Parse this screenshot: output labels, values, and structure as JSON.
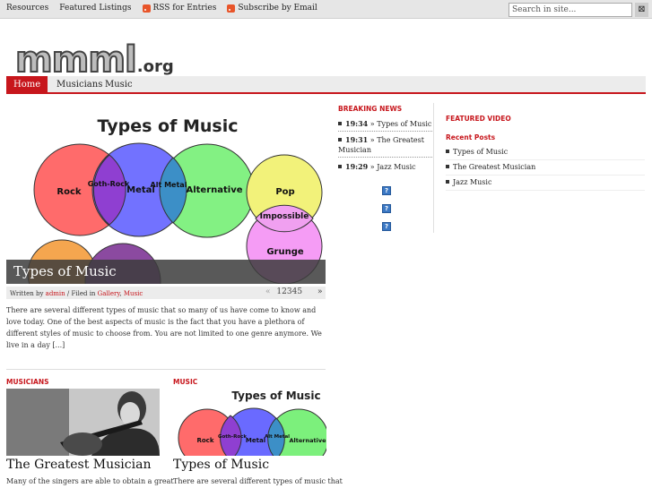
{
  "topbar": {
    "links": [
      "Resources",
      "Featured Listings"
    ],
    "rss_label": "RSS for Entries",
    "email_label": "Subscribe by Email",
    "search_placeholder": "Search in site..."
  },
  "logo": {
    "main": "mmml",
    "suffix": ".org"
  },
  "nav": {
    "items": [
      "Home",
      "Musicians",
      "Music"
    ],
    "active": "Home"
  },
  "featured": {
    "image": {
      "heading": "Types of Music",
      "labels": [
        "Rock",
        "Goth-Rock",
        "Metal",
        "Alt Metal",
        "Alternative",
        "Pop",
        "Impossible",
        "Grunge"
      ]
    },
    "title": "Types of Music",
    "meta_prefix": "Written by",
    "author": "admin",
    "filed_prefix": "/ Filed in",
    "categories": [
      "Gallery",
      "Music"
    ],
    "pages": [
      "1",
      "2",
      "3",
      "4",
      "5"
    ],
    "prev_arrow": "«",
    "next_arrow": "»",
    "excerpt": "There are several different types of music that so many of us have come to know and love today. One of the best aspects of music is the fact that you have a plethora of different styles of music to choose from. You are not limited to one genre anymore. We live in a day [...]"
  },
  "sections": [
    {
      "label": "MUSICIANS",
      "title": "The Greatest Musician",
      "text": "Many of the singers are able to obtain a great"
    },
    {
      "label": "MUSIC",
      "title": "Types of Music",
      "text": "There are several different types of music that",
      "image": {
        "heading": "Types of Music",
        "labels": [
          "Rock",
          "Goth-Rock",
          "Metal",
          "Alt Metal",
          "Alternative"
        ]
      }
    }
  ],
  "breaking": {
    "title": "BREAKING NEWS",
    "items": [
      {
        "time": "19:34",
        "sep": "»",
        "text": "Types of Music"
      },
      {
        "time": "19:31",
        "sep": "»",
        "text": "The Greatest Musician"
      },
      {
        "time": "19:29",
        "sep": "»",
        "text": "Jazz Music"
      }
    ],
    "icon_glyph": "?"
  },
  "right": {
    "featured_video": "FEATURED VIDEO",
    "recent_title": "Recent Posts",
    "recent": [
      "Types of Music",
      "The Greatest Musician",
      "Jazz Music"
    ]
  },
  "colors": {
    "accent": "#c7161c",
    "rock": "#ff6b6b",
    "metal": "#6a6aff",
    "alternative": "#7cf07c",
    "pop": "#f2f27a",
    "grunge": "#f59cf5",
    "goth": "#8f3fd1"
  }
}
